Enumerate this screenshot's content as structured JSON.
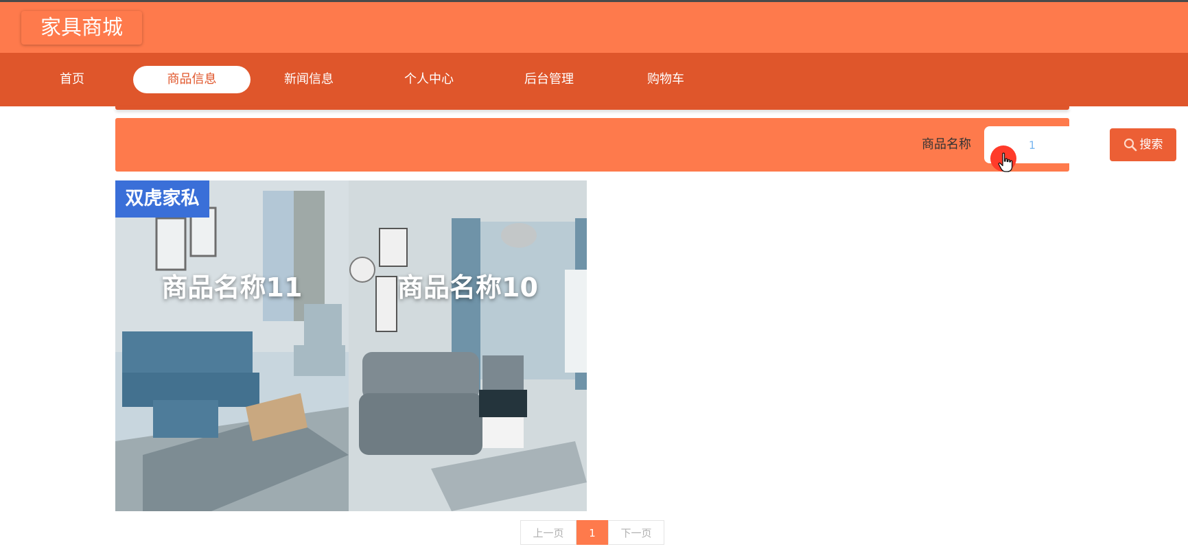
{
  "site": {
    "title": "家具商城"
  },
  "nav": {
    "items": [
      {
        "label": "首页"
      },
      {
        "label": "商品信息",
        "active": true
      },
      {
        "label": "新闻信息"
      },
      {
        "label": "个人中心"
      },
      {
        "label": "后台管理"
      },
      {
        "label": "购物车"
      }
    ]
  },
  "search": {
    "label": "商品名称",
    "value": "1",
    "button_label": "搜索",
    "icon": "search-icon"
  },
  "products": [
    {
      "name": "商品名称11",
      "brand": "双虎家私"
    },
    {
      "name": "商品名称10"
    }
  ],
  "pagination": {
    "prev_label": "上一页",
    "current_page": "1",
    "next_label": "下一页"
  },
  "colors": {
    "header": "#fe7a4c",
    "nav": "#df562b",
    "accent": "#ec5f35",
    "brand_badge": "#3a6fd8"
  }
}
